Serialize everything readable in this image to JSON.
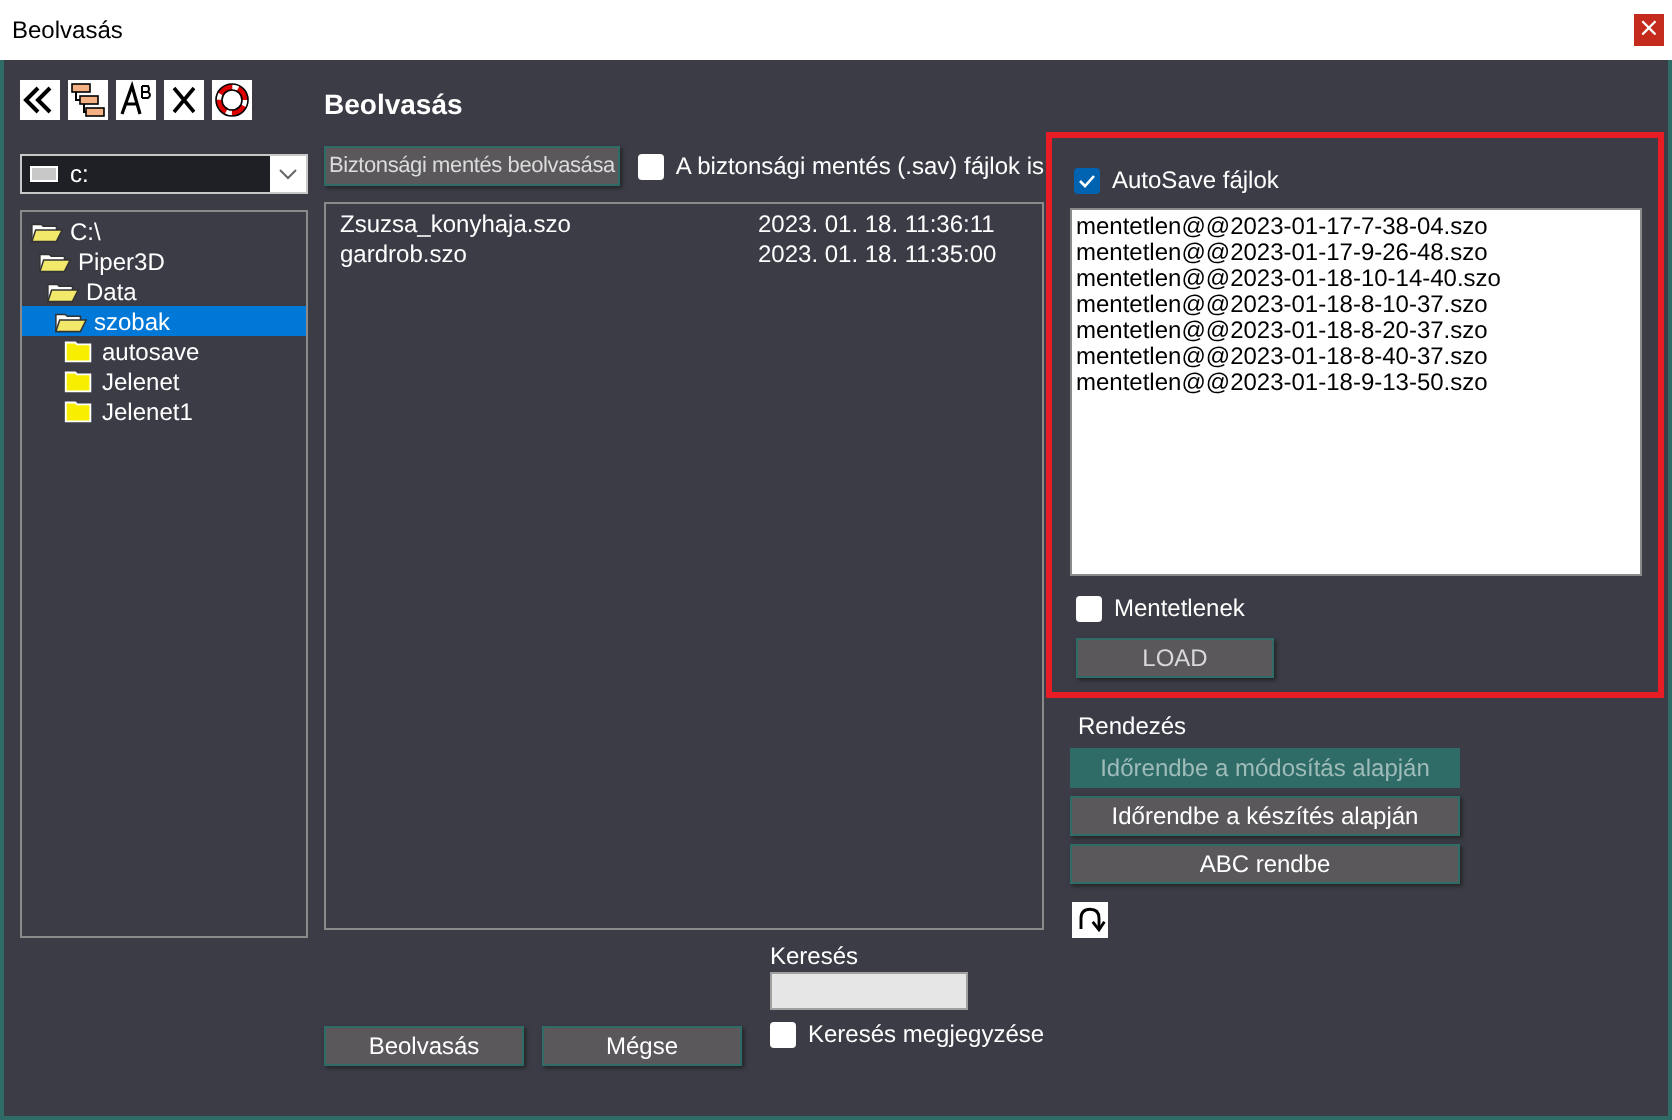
{
  "window": {
    "title": "Beolvasás",
    "close_label": "×"
  },
  "toolbar": [
    {
      "kind": "collapse"
    },
    {
      "kind": "tree"
    },
    {
      "kind": "spell"
    },
    {
      "kind": "delete"
    },
    {
      "kind": "help"
    }
  ],
  "heading": "Beolvasás",
  "drive": {
    "value": "c:"
  },
  "tree": [
    {
      "label": "C:\\",
      "expanded": true,
      "selected": false,
      "children": [
        {
          "label": "Piper3D",
          "expanded": true,
          "selected": false,
          "children": [
            {
              "label": "Data",
              "expanded": true,
              "selected": false,
              "children": [
                {
                  "label": "szobak",
                  "expanded": true,
                  "selected": true,
                  "children": [
                    {
                      "label": "autosave",
                      "expanded": false,
                      "selected": false
                    },
                    {
                      "label": "Jelenet",
                      "expanded": false,
                      "selected": false
                    },
                    {
                      "label": "Jelenet1",
                      "expanded": false,
                      "selected": false
                    }
                  ]
                }
              ]
            }
          ]
        }
      ]
    }
  ],
  "backup_button": "Biztonsági mentés beolvasása",
  "backup_checkbox": {
    "label": "A biztonsági mentés (.sav) fájlok is",
    "checked": false
  },
  "files": [
    {
      "name": "Zsuzsa_konyhaja.szo",
      "date": "2023. 01. 18. 11:36:11"
    },
    {
      "name": "gardrob.szo",
      "date": "2023. 01. 18. 11:35:00"
    }
  ],
  "autosave": {
    "checkbox": {
      "label": "AutoSave fájlok",
      "checked": true
    },
    "files": [
      "mentetlen@@2023-01-17-7-38-04.szo",
      "mentetlen@@2023-01-17-9-26-48.szo",
      "mentetlen@@2023-01-18-10-14-40.szo",
      "mentetlen@@2023-01-18-8-10-37.szo",
      "mentetlen@@2023-01-18-8-20-37.szo",
      "mentetlen@@2023-01-18-8-40-37.szo",
      "mentetlen@@2023-01-18-9-13-50.szo"
    ],
    "unsaved_checkbox": {
      "label": "Mentetlenek",
      "checked": false
    },
    "load_button": "LOAD"
  },
  "sort": {
    "label": "Rendezés",
    "buttons": [
      {
        "label": "Időrendbe a módosítás alapján",
        "selected": true
      },
      {
        "label": "Időrendbe a készítés alapján",
        "selected": false
      },
      {
        "label": "ABC rendbe",
        "selected": false
      }
    ]
  },
  "search": {
    "label": "Keresés",
    "remember": {
      "label": "Keresés megjegyzése",
      "checked": false
    }
  },
  "buttons": [
    "Beolvasás",
    "Mégse"
  ]
}
